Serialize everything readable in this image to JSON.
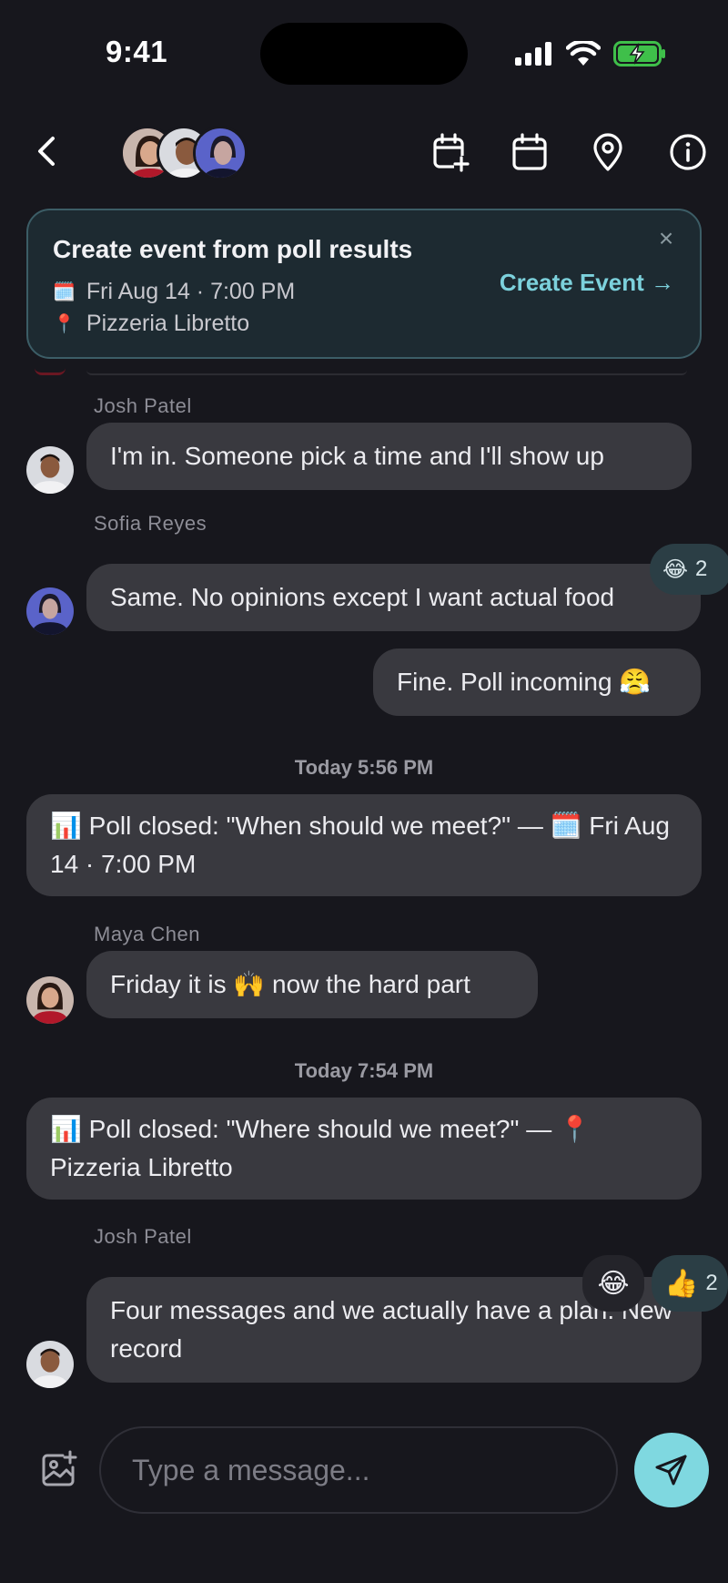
{
  "status_bar": {
    "time": "9:41"
  },
  "banner": {
    "title": "Create event from poll results",
    "date_icon": "calendar-emoji",
    "date": "Fri Aug 14 · 7:00 PM",
    "place_icon": "pin-emoji",
    "place": "Pizzeria Libretto",
    "cta": "Create Event →",
    "close": "×"
  },
  "messages": [
    {
      "sender": "Josh Patel",
      "text": "I'm in. Someone pick a time and I'll show up"
    },
    {
      "sender": "Sofia Reyes",
      "text": "Same. No opinions except I want actual food",
      "reaction": {
        "emoji": "😂",
        "count": "2"
      }
    },
    {
      "text": "Fine. Poll incoming 😤"
    },
    {
      "timestamp": "Today 5:56 PM"
    },
    {
      "system": "📊  Poll closed: \"When should we meet?\" — 🗓️ Fri Aug 14 · 7:00 PM"
    },
    {
      "sender": "Maya Chen",
      "text": "Friday it is 🙌  now the hard part"
    },
    {
      "timestamp": "Today 7:54 PM"
    },
    {
      "system": "📊  Poll closed: \"Where should we meet?\" — 📍 Pizzeria Libretto"
    },
    {
      "sender": "Josh Patel",
      "text": "Four messages and we actually have a plan. New record",
      "reactions": [
        {
          "emoji": "😂"
        },
        {
          "emoji": "👍",
          "count": "2"
        }
      ]
    }
  ],
  "composer": {
    "placeholder": "Type a message..."
  },
  "colors": {
    "accent": "#7fd8e0",
    "background": "#17171d",
    "bubble": "#39393f"
  }
}
